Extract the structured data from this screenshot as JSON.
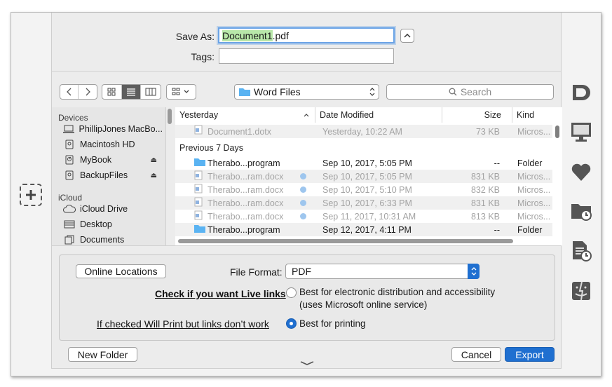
{
  "save": {
    "save_as_label": "Save As:",
    "filename_base": "Document1",
    "filename_ext": ".pdf",
    "tags_label": "Tags:",
    "tags_value": ""
  },
  "toolbar": {
    "location": "Word Files",
    "search_placeholder": "Search"
  },
  "sidebar": {
    "devices_header": "Devices",
    "devices": [
      {
        "label": "PhillipJones MacBo...",
        "icon": "laptop-icon"
      },
      {
        "label": "Macintosh HD",
        "icon": "disk-icon"
      },
      {
        "label": "MyBook",
        "icon": "external-disk-icon",
        "eject": true
      },
      {
        "label": "BackupFiles",
        "icon": "disk-icon",
        "eject": true
      }
    ],
    "icloud_header": "iCloud",
    "icloud": [
      {
        "label": "iCloud Drive",
        "icon": "cloud-icon"
      },
      {
        "label": "Desktop",
        "icon": "desktop-icon"
      },
      {
        "label": "Documents",
        "icon": "documents-icon"
      }
    ]
  },
  "filelist": {
    "columns": [
      "Yesterday",
      "Date Modified",
      "Size",
      "Kind"
    ],
    "yesterday_rows": [
      {
        "name": "Document1.dotx",
        "date": "Yesterday, 10:22 AM",
        "size": "73 KB",
        "kind": "Micros...",
        "type": "doc",
        "dim": true
      }
    ],
    "group2_label": "Previous 7 Days",
    "rows": [
      {
        "name": "Therabo...program",
        "date": "Sep 10, 2017, 5:05 PM",
        "size": "--",
        "kind": "Folder",
        "type": "folder",
        "dim": false
      },
      {
        "name": "Therabo...ram.docx",
        "date": "Sep 10, 2017, 5:05 PM",
        "size": "831 KB",
        "kind": "Micros...",
        "type": "doc",
        "dim": true
      },
      {
        "name": "Therabo...ram.docx",
        "date": "Sep 10, 2017, 5:10 PM",
        "size": "832 KB",
        "kind": "Micros...",
        "type": "doc",
        "dim": true
      },
      {
        "name": "Therabo...ram.docx",
        "date": "Sep 10, 2017, 6:33 PM",
        "size": "831 KB",
        "kind": "Micros...",
        "type": "doc",
        "dim": true
      },
      {
        "name": "Therabo...ram.docx",
        "date": "Sep 11, 2017, 10:31 AM",
        "size": "813 KB",
        "kind": "Micros...",
        "type": "doc",
        "dim": true
      },
      {
        "name": "Therabo...program",
        "date": "Sep 12, 2017, 4:11 PM",
        "size": "--",
        "kind": "Folder",
        "type": "folder",
        "dim": false
      }
    ]
  },
  "options": {
    "online_locations": "Online Locations",
    "file_format_label": "File Format:",
    "file_format_value": "PDF",
    "note1": "Check if you want Live links",
    "option1_line1": "Best for electronic distribution and accessibility",
    "option1_line2": "(uses Microsoft online service)",
    "note2": "If checked Will Print but links don’t work",
    "option2": "Best for printing",
    "selected_option": 2
  },
  "footer": {
    "new_folder": "New Folder",
    "cancel": "Cancel",
    "export": "Export"
  },
  "colors": {
    "accent": "#1f6fd0",
    "filename_highlight": "#b8e7a9",
    "folder": "#5ab3f2"
  }
}
